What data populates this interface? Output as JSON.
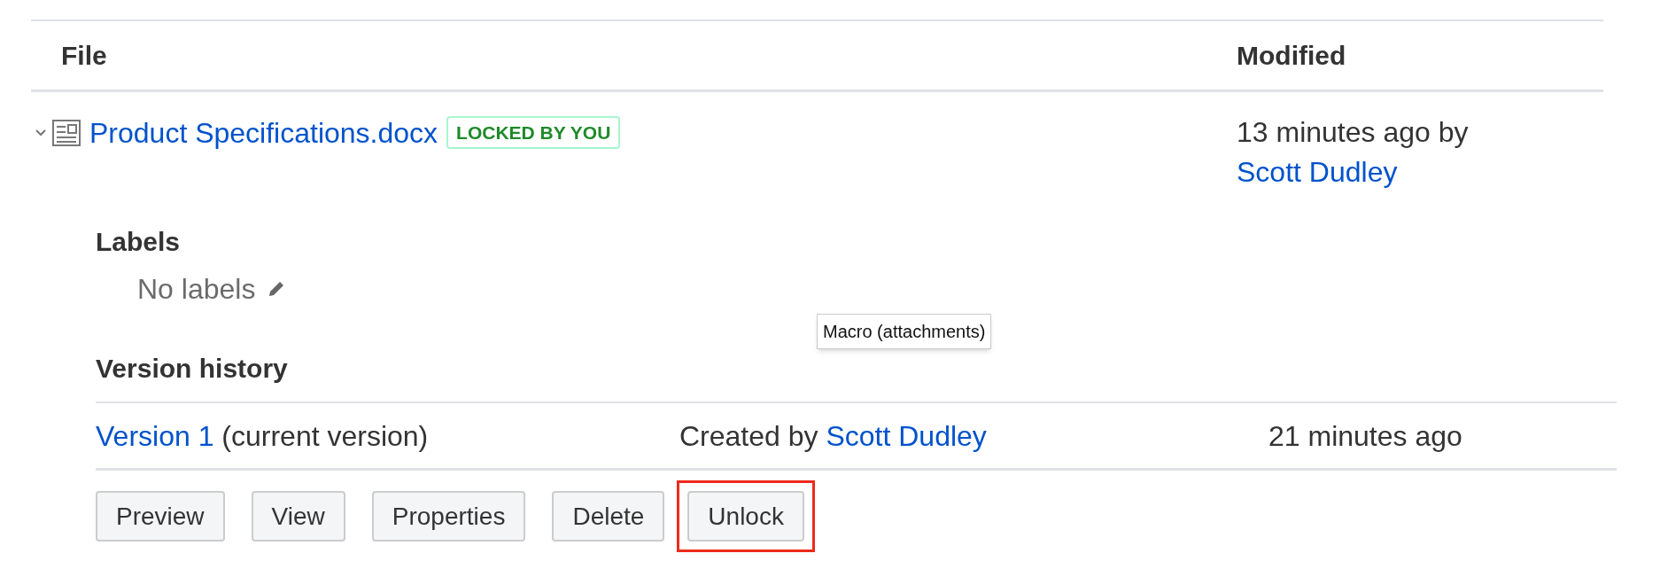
{
  "table": {
    "columns": [
      "File",
      "Modified"
    ],
    "rows": [
      {
        "expanded": true,
        "file": "Product Specifications.docx",
        "badge": "LOCKED BY YOU",
        "modified_text": "13 minutes ago by",
        "modified_by": "Scott Dudley",
        "labels": {
          "heading": "Labels",
          "empty_text": "No labels"
        },
        "version_history": {
          "heading": "Version history",
          "versions": [
            {
              "link": "Version 1",
              "note": "(current version)",
              "created_label": "Created by",
              "created_by": "Scott Dudley",
              "time": "21 minutes ago"
            }
          ]
        },
        "buttons": [
          {
            "label": "Preview",
            "highlighted": false
          },
          {
            "label": "View",
            "highlighted": false
          },
          {
            "label": "Properties",
            "highlighted": false
          },
          {
            "label": "Delete",
            "highlighted": false
          },
          {
            "label": "Unlock",
            "highlighted": true
          }
        ]
      }
    ]
  },
  "tooltip": {
    "text": "Macro (attachments)"
  }
}
